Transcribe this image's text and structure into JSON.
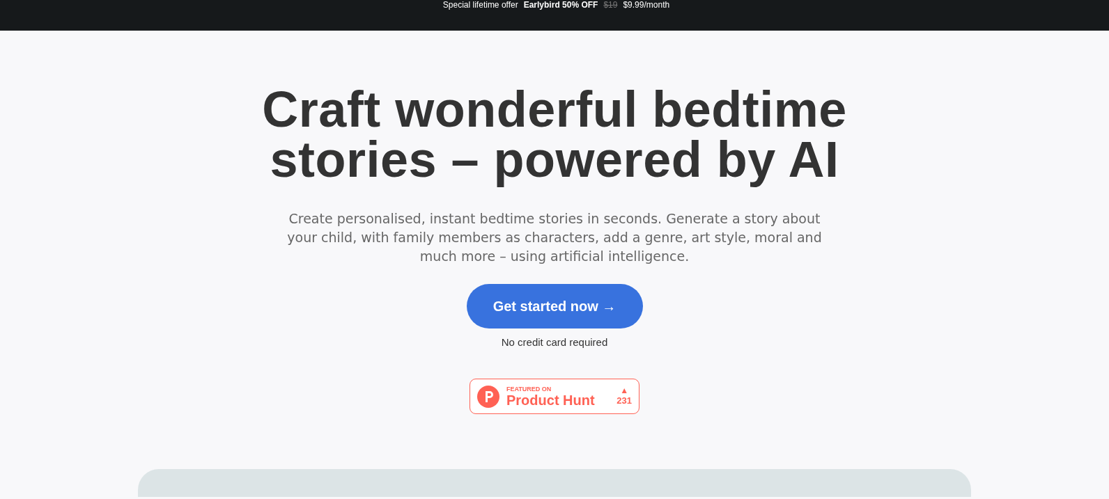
{
  "promo_bar": {
    "label": "Special lifetime offer",
    "offer": "Earlybird 50% OFF",
    "old_price": "$19",
    "new_price": "$9.99/month"
  },
  "hero": {
    "headline": "Craft wonderful bedtime stories – powered by AI",
    "subtitle": "Create personalised, instant bedtime stories in seconds. Generate a story about your child, with family members as characters, add a genre, art style, moral and much more – using artificial intelligence.",
    "cta": "Get started now →",
    "note": "No credit card required"
  },
  "badge": {
    "kicker": "FEATURED ON",
    "name": "Product Hunt",
    "arrow": "▲",
    "count": "231"
  }
}
